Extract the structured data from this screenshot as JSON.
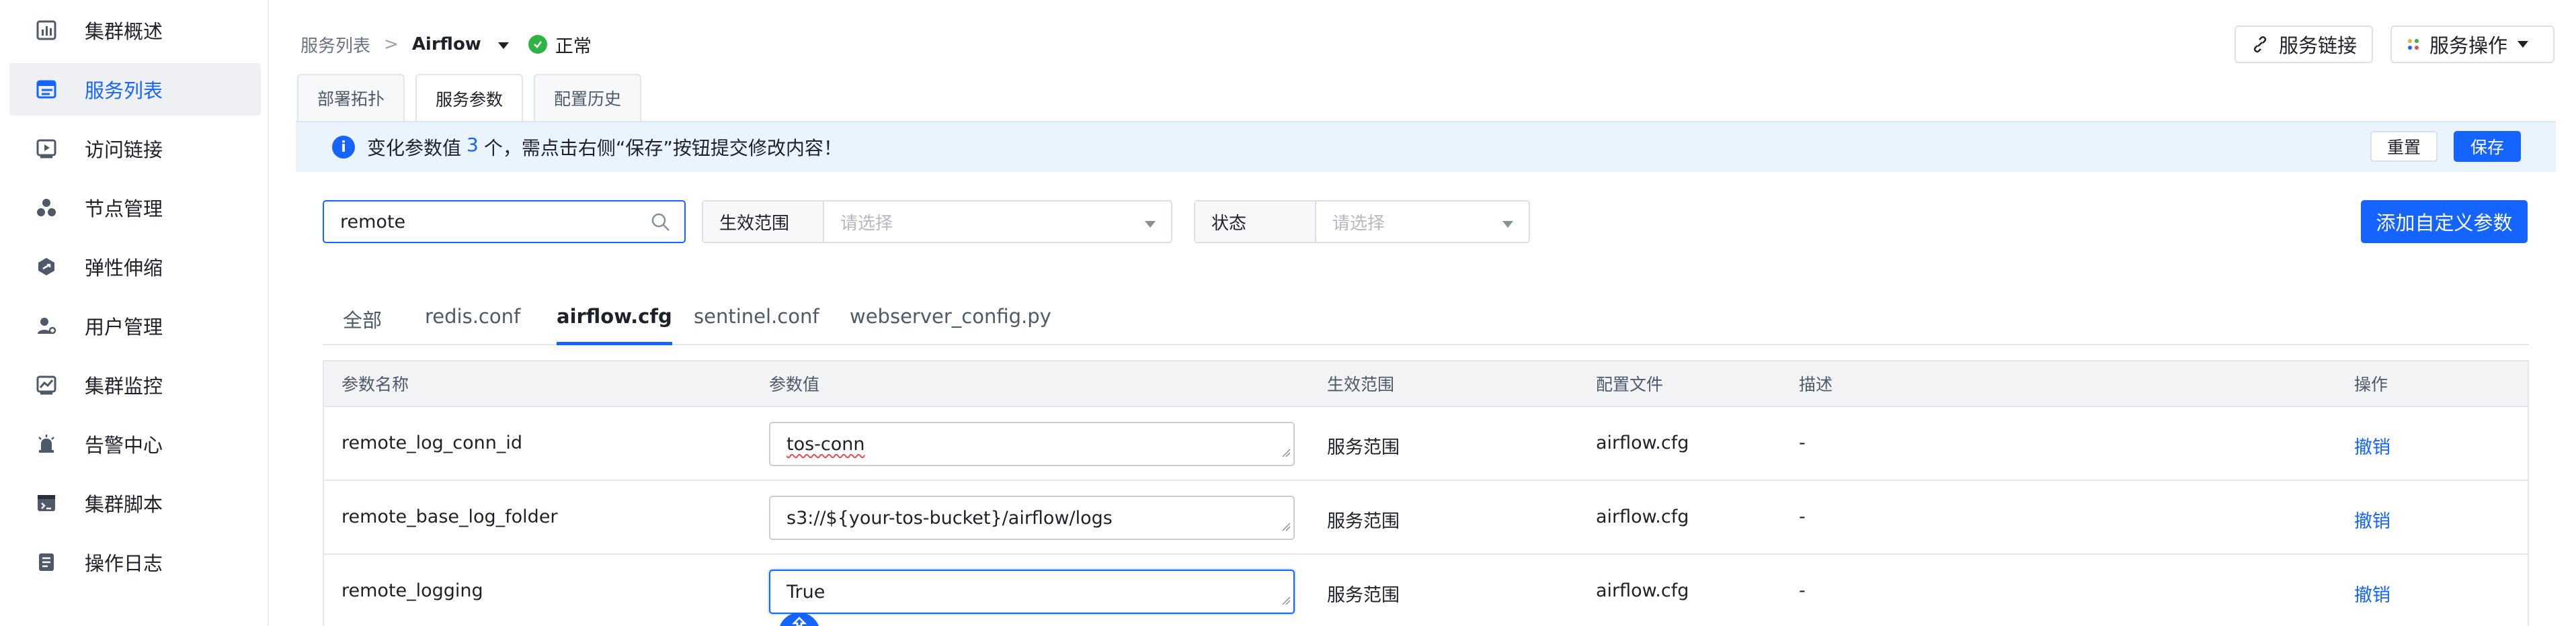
{
  "sidebar": {
    "items": [
      {
        "label": "集群概述",
        "icon": "bar-chart-icon"
      },
      {
        "label": "服务列表",
        "icon": "table-list-icon",
        "active": true
      },
      {
        "label": "访问链接",
        "icon": "play-link-icon"
      },
      {
        "label": "节点管理",
        "icon": "nodes-icon"
      },
      {
        "label": "弹性伸缩",
        "icon": "scale-icon"
      },
      {
        "label": "用户管理",
        "icon": "user-icon"
      },
      {
        "label": "集群监控",
        "icon": "monitor-icon"
      },
      {
        "label": "告警中心",
        "icon": "alarm-icon"
      },
      {
        "label": "集群脚本",
        "icon": "script-icon"
      },
      {
        "label": "操作日志",
        "icon": "log-icon"
      }
    ]
  },
  "header": {
    "breadcrumb_root": "服务列表",
    "breadcrumb_sep": ">",
    "service_name": "Airflow",
    "status": "正常",
    "service_link_label": "服务链接",
    "service_ops_label": "服务操作"
  },
  "top_tabs": [
    {
      "label": "部署拓扑"
    },
    {
      "label": "服务参数",
      "active": true
    },
    {
      "label": "配置历史"
    }
  ],
  "banner": {
    "prefix": "变化参数值",
    "count": "3",
    "suffix": "个，需点击右侧“保存”按钮提交修改内容！",
    "reset_label": "重置",
    "save_label": "保存"
  },
  "filters": {
    "search_value": "remote",
    "scope_label": "生效范围",
    "scope_placeholder": "请选择",
    "state_label": "状态",
    "state_placeholder": "请选择",
    "add_label": "添加自定义参数"
  },
  "file_tabs": [
    {
      "label": "全部"
    },
    {
      "label": "redis.conf"
    },
    {
      "label": "airflow.cfg",
      "active": true
    },
    {
      "label": "sentinel.conf"
    },
    {
      "label": "webserver_config.py"
    }
  ],
  "table": {
    "headers": {
      "name": "参数名称",
      "value": "参数值",
      "scope": "生效范围",
      "file": "配置文件",
      "desc": "描述",
      "action": "操作"
    },
    "rows": [
      {
        "name": "remote_log_conn_id",
        "value": "tos-conn",
        "scope": "服务范围",
        "file": "airflow.cfg",
        "desc": "-",
        "action": "撤销"
      },
      {
        "name": "remote_base_log_folder",
        "value": "s3://${your-tos-bucket}/airflow/logs",
        "scope": "服务范围",
        "file": "airflow.cfg",
        "desc": "-",
        "action": "撤销"
      },
      {
        "name": "remote_logging",
        "value": "True",
        "scope": "服务范围",
        "file": "airflow.cfg",
        "desc": "-",
        "action": "撤销"
      }
    ]
  },
  "colors": {
    "accent": "#1664ff",
    "status_ok": "#2fb344",
    "banner_bg": "#e9f4ff"
  }
}
